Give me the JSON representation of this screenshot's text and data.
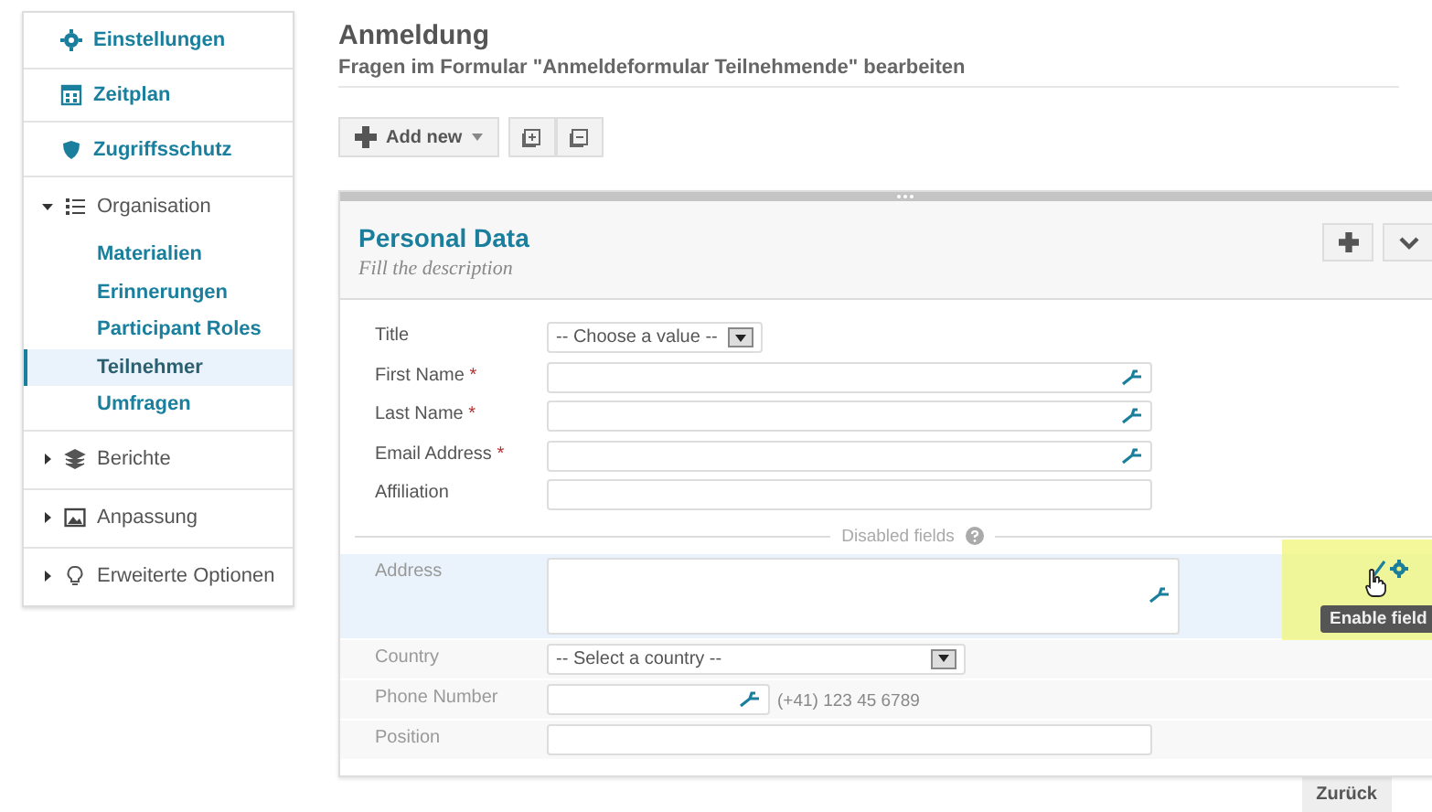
{
  "sidebar": {
    "items": [
      {
        "label": "Einstellungen",
        "selected": false
      },
      {
        "label": "Zeitplan",
        "selected": false
      },
      {
        "label": "Zugriffsschutz",
        "selected": false
      },
      {
        "label": "Organisation",
        "selected": false,
        "expanded": true,
        "children": [
          {
            "label": "Materialien",
            "selected": false
          },
          {
            "label": "Erinnerungen",
            "selected": false
          },
          {
            "label": "Participant Roles",
            "selected": false
          },
          {
            "label": "Teilnehmer",
            "selected": true
          },
          {
            "label": "Umfragen",
            "selected": false
          }
        ]
      },
      {
        "label": "Berichte",
        "selected": false,
        "expanded": false
      },
      {
        "label": "Anpassung",
        "selected": false,
        "expanded": false
      },
      {
        "label": "Erweiterte Optionen",
        "selected": false,
        "expanded": false
      }
    ]
  },
  "page": {
    "title": "Anmeldung",
    "subtitle": "Fragen im Formular \"Anmeldeformular Teilnehmende\" bearbeiten"
  },
  "toolbar": {
    "add_button": "Add new"
  },
  "section": {
    "title": "Personal Data",
    "description": "Fill the description",
    "required_mark": "*",
    "fields": [
      {
        "label": "Title",
        "kind": "select",
        "value": "-- Choose a value --",
        "required": false
      },
      {
        "label": "First Name",
        "kind": "text",
        "required": true,
        "picker": true
      },
      {
        "label": "Last Name",
        "kind": "text",
        "required": true,
        "picker": true
      },
      {
        "label": "Email Address",
        "kind": "text",
        "required": true,
        "picker": true
      },
      {
        "label": "Affiliation",
        "kind": "text",
        "required": false,
        "picker": false
      }
    ],
    "disabled_label": "Disabled fields",
    "disabled_fields": [
      {
        "label": "Address",
        "kind": "textarea",
        "required": false,
        "picker": true,
        "highlighted": true,
        "tooltip": "Enable field"
      },
      {
        "label": "Country",
        "kind": "select",
        "value": "-- Select a country --",
        "required": false,
        "highlighted": false
      },
      {
        "label": "Phone Number",
        "kind": "phone",
        "required": false,
        "picker": true,
        "hint": "(+41) 123 45 6789",
        "highlighted": false
      },
      {
        "label": "Position",
        "kind": "text",
        "required": false,
        "picker": false,
        "highlighted": false
      }
    ]
  },
  "footer": {
    "back_button": "Zurück"
  }
}
